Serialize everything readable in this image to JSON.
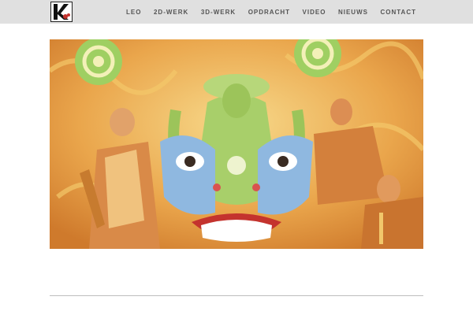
{
  "header": {
    "background": "#e0e0e0",
    "logo_icon": "koenraads-logo-icon",
    "nav": [
      {
        "label": "LEO"
      },
      {
        "label": "2D-WERK"
      },
      {
        "label": "3D-WERK"
      },
      {
        "label": "OPDRACHT"
      },
      {
        "label": "VIDEO"
      },
      {
        "label": "NIEUWS"
      },
      {
        "label": "CONTACT"
      }
    ]
  },
  "hero": {
    "image_icon": "painting-image",
    "palette": {
      "orange": "#e8a24a",
      "yellow": "#f1c76b",
      "green": "#a8cf6a",
      "blue": "#8fb8e0",
      "red": "#c4332e"
    }
  },
  "divider": {
    "color": "#bdbdbd"
  }
}
